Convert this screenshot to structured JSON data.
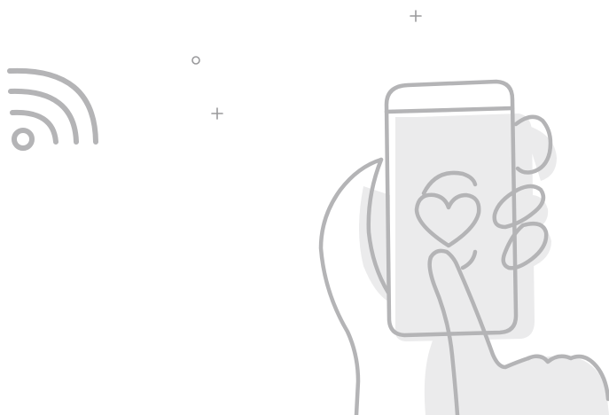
{
  "colors": {
    "background": "#ffffff",
    "line": "#b4b4b6",
    "shadow": "#ebebec",
    "sparkle": "#9a9a9c"
  },
  "icons": {
    "signal": "wifi-signal-icon",
    "phone": "smartphone-icon",
    "heart": "heart-icon",
    "hand": "hand-icon",
    "sparkle_plus": "plus-sparkle-icon",
    "sparkle_circle": "circle-sparkle-icon"
  }
}
